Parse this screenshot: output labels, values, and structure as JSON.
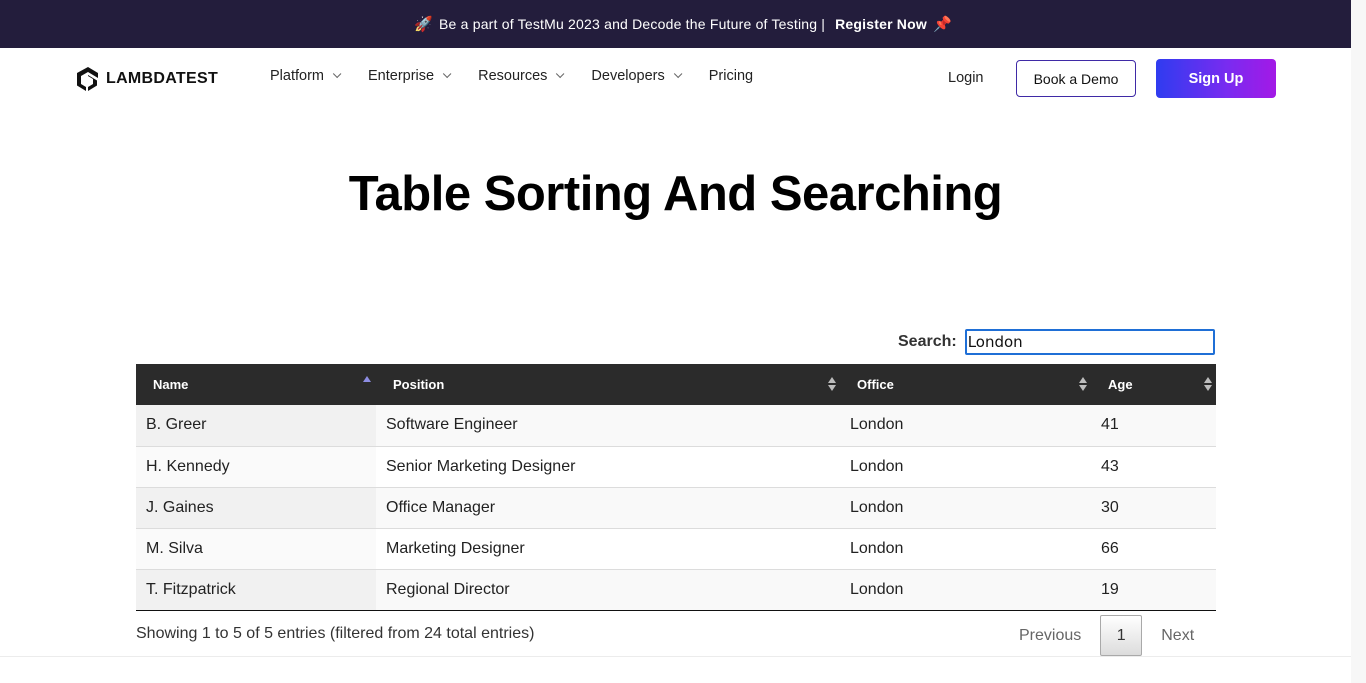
{
  "banner": {
    "text": "Be a part of TestMu 2023 and Decode the Future of Testing",
    "separator": "|",
    "link": "Register Now"
  },
  "nav": {
    "logo": "LAMBDATEST",
    "menu": [
      {
        "label": "Platform"
      },
      {
        "label": "Enterprise"
      },
      {
        "label": "Resources"
      },
      {
        "label": "Developers"
      },
      {
        "label": "Pricing"
      }
    ],
    "login": "Login",
    "book_demo": "Book a Demo",
    "sign_up": "Sign Up"
  },
  "main": {
    "title": "Table Sorting And Searching",
    "search_label": "Search:",
    "search_value": "London",
    "table": {
      "headers": [
        "Name",
        "Position",
        "Office",
        "Age"
      ],
      "rows": [
        [
          "B. Greer",
          "Software Engineer",
          "London",
          "41"
        ],
        [
          "H. Kennedy",
          "Senior Marketing Designer",
          "London",
          "43"
        ],
        [
          "J. Gaines",
          "Office Manager",
          "London",
          "30"
        ],
        [
          "M. Silva",
          "Marketing Designer",
          "London",
          "66"
        ],
        [
          "T. Fitzpatrick",
          "Regional Director",
          "London",
          "19"
        ]
      ]
    },
    "info": "Showing 1 to 5 of 5 entries (filtered from 24 total entries)",
    "pagination": {
      "previous": "Previous",
      "page": "1",
      "next": "Next"
    }
  },
  "colors": {
    "banner_bg": "#231d3c",
    "table_header_bg": "#2b2b2b",
    "signup_gradient_start": "#2f3cf0",
    "signup_gradient_end": "#a319e6",
    "search_border": "#1f6fd6"
  }
}
